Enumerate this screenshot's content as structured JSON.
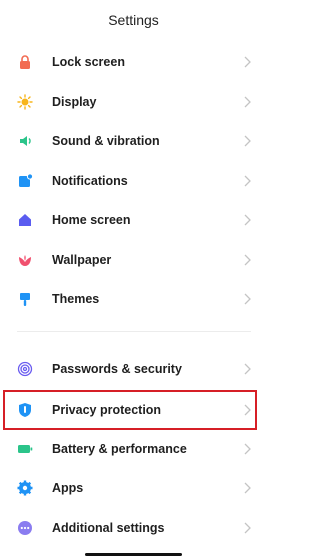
{
  "header": {
    "title": "Settings"
  },
  "items": [
    {
      "label": "Lock screen",
      "icon": "lock-icon",
      "color": "#f26b52"
    },
    {
      "label": "Display",
      "icon": "sun-icon",
      "color": "#f7b51c"
    },
    {
      "label": "Sound & vibration",
      "icon": "speaker-icon",
      "color": "#2bc48a"
    },
    {
      "label": "Notifications",
      "icon": "notification-icon",
      "color": "#1f93f5"
    },
    {
      "label": "Home screen",
      "icon": "home-icon",
      "color": "#5a5cf0"
    },
    {
      "label": "Wallpaper",
      "icon": "wallpaper-flower-icon",
      "color": "#f0506e"
    },
    {
      "label": "Themes",
      "icon": "brush-icon",
      "color": "#1f93f5"
    },
    {
      "label": "Passwords & security",
      "icon": "fingerprint-icon",
      "color": "#6a5cf0"
    },
    {
      "label": "Privacy protection",
      "icon": "privacy-shield-icon",
      "color": "#1f93f5"
    },
    {
      "label": "Battery & performance",
      "icon": "battery-icon",
      "color": "#2bc48a"
    },
    {
      "label": "Apps",
      "icon": "gear-icon",
      "color": "#1f93f5"
    },
    {
      "label": "Additional settings",
      "icon": "more-dots-icon",
      "color": "#8a7cf0"
    }
  ],
  "highlighted_item": "Privacy protection",
  "highlight_color": "#d61f26"
}
